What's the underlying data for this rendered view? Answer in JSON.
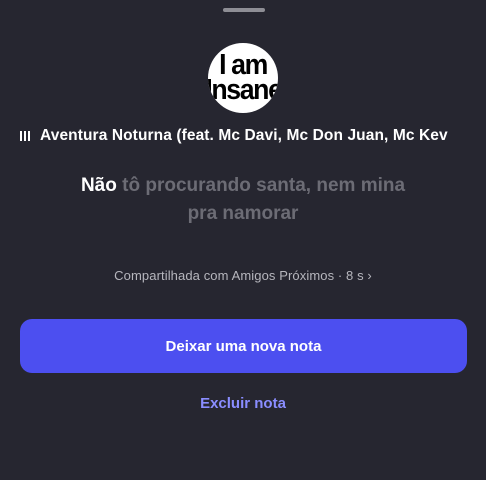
{
  "header": {
    "grabber_icon": "drag-handle"
  },
  "note": {
    "avatar_text_line1": "I am",
    "avatar_text_line2": "Insane",
    "play_icon": "play-pause-icon",
    "song_title": "Aventura Noturna (feat. Mc Davi, Mc Don Juan, Mc Kev",
    "lyrics_sung": "Não",
    "lyrics_upcoming_line1": "tô procurando santa, nem mina",
    "lyrics_upcoming_line2": "pra namorar",
    "shared_text": "Compartilhada com Amigos Próximos · 8 s ›"
  },
  "actions": {
    "new_note_label": "Deixar uma nova nota",
    "delete_label": "Excluir nota"
  },
  "colors": {
    "background": "#262630",
    "primary": "#4c4ff0",
    "link": "#8a8dff",
    "muted_lyrics": "#6c6c75"
  }
}
